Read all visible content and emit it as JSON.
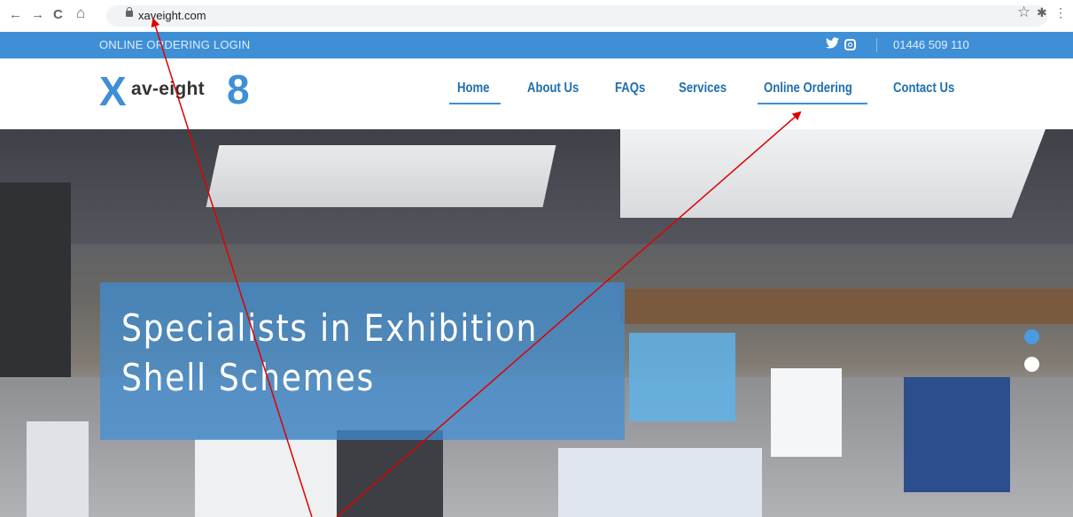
{
  "browser": {
    "back_icon": "←",
    "forward_icon": "→",
    "reload_icon": "C",
    "home_icon": "⌂",
    "url": "xaveight.com",
    "star_icon": "☆",
    "extension_icon": "✱",
    "menu_icon": "⋮"
  },
  "topbar": {
    "login_link": "ONLINE ORDERING LOGIN",
    "twitter_icon": "🐦",
    "phone": "01446 509 110",
    "color": "#3f8fd6"
  },
  "logo": {
    "x": "X",
    "text": "av-eight",
    "eight": "8"
  },
  "menu": {
    "items": [
      {
        "label": "Home",
        "active": true
      },
      {
        "label": "About Us"
      },
      {
        "label": "FAQs"
      },
      {
        "label": "Services"
      },
      {
        "label": "Online Ordering",
        "active": true
      },
      {
        "label": "Contact Us"
      }
    ]
  },
  "hero": {
    "headline_line1": "Specialists in Exhibition",
    "headline_line2": "Shell Schemes"
  },
  "slider": {
    "dots": [
      {
        "state": "active",
        "color": "#4a9be0"
      },
      {
        "state": "inactive",
        "color": "#ffffff"
      }
    ]
  },
  "annotation": {
    "arrow_color": "#e00000"
  }
}
